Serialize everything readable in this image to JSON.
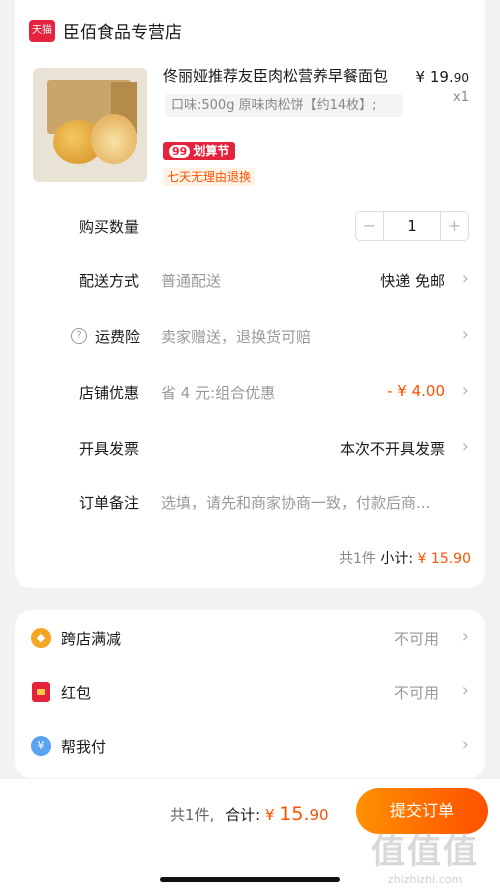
{
  "shop": {
    "logo_text": "天猫",
    "name": "臣佰食品专营店"
  },
  "product": {
    "title": "佟丽娅推荐友臣肉松营养早餐面包",
    "price_prefix": "¥",
    "price_int": "19.",
    "price_dec": "90",
    "quantity_label": "x1",
    "spec": "口味:500g 原味肉松饼【约14枚】;",
    "promo_badge_num": "99",
    "promo_badge_text": "划算节",
    "return_policy": "七天无理由退换"
  },
  "rows": {
    "quantity": {
      "label": "购买数量",
      "value": "1",
      "minus": "−",
      "plus": "+"
    },
    "delivery": {
      "label": "配送方式",
      "sub": "普通配送",
      "value": "快递 免邮"
    },
    "insurance": {
      "label": "运费险",
      "sub": "卖家赠送，退换货可赔"
    },
    "discount": {
      "label": "店铺优惠",
      "sub": "省 4 元:组合优惠",
      "value": "- ¥ 4.00"
    },
    "invoice": {
      "label": "开具发票",
      "value": "本次不开具发票"
    },
    "note": {
      "label": "订单备注",
      "placeholder": "选填，请先和商家协商一致，付款后商..."
    }
  },
  "subtotal": {
    "count": "共1件",
    "label": "小计:",
    "prefix": "¥",
    "amount_int": "15.",
    "amount_dec": "90"
  },
  "benefits": {
    "cross_store": {
      "label": "跨店满减",
      "value": "不可用"
    },
    "red_packet": {
      "label": "红包",
      "value": "不可用"
    },
    "help_pay": {
      "label": "帮我付"
    }
  },
  "footer": {
    "count": "共1件,",
    "total_label": "合计:",
    "prefix": "¥",
    "amount_int": "15.",
    "amount_dec": "90",
    "submit_label": "提交订单"
  },
  "watermark": {
    "logo": "值值值",
    "url": "zhizhizhi.com"
  },
  "icons": {
    "chevron": "chevron-right-icon",
    "help": "question-circle-icon"
  },
  "colors": {
    "accent": "#ff5000",
    "brand": "#e5233c"
  }
}
